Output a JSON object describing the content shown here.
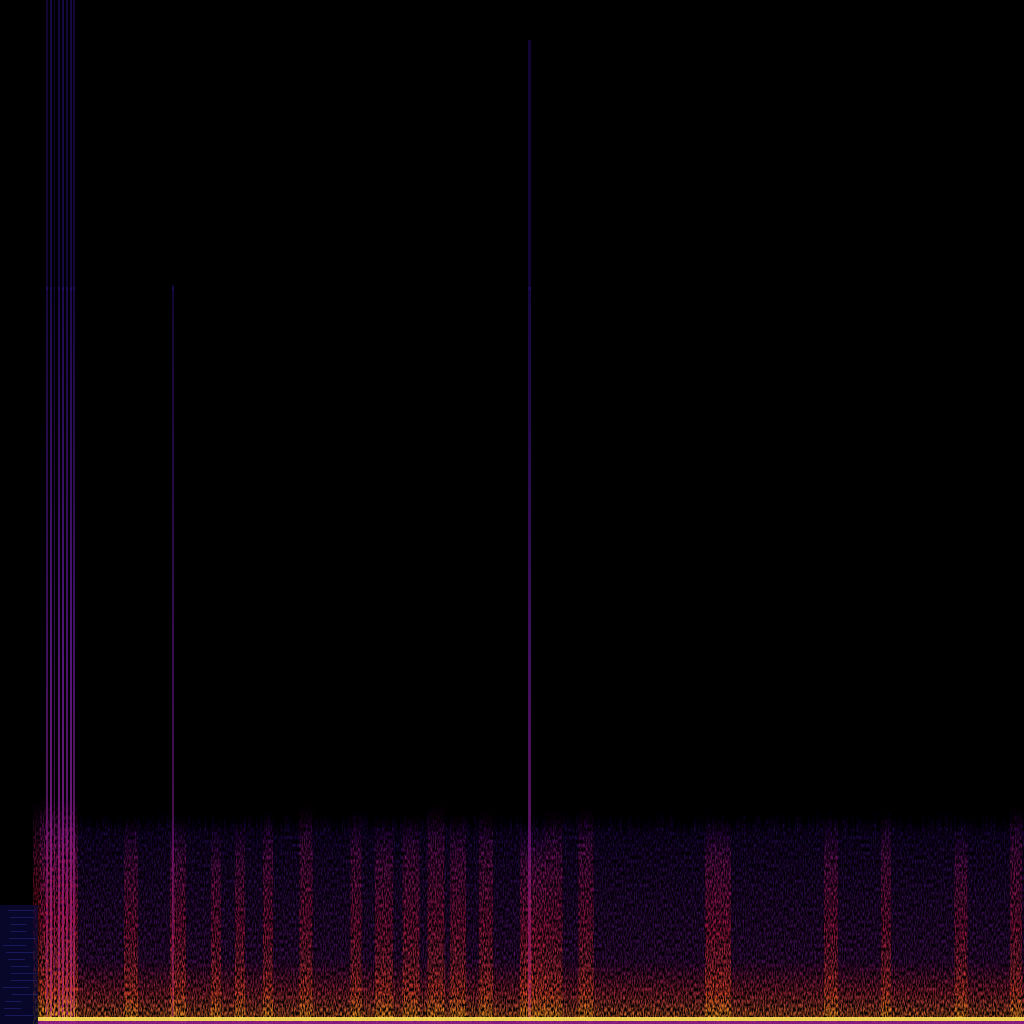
{
  "image": {
    "kind": "spectrogram",
    "colormap": "inferno-like",
    "background_color": "#000000",
    "palette": {
      "low": "#1a0a4a",
      "mid_low": "#4b0f7a",
      "mid": "#8a1a8a",
      "mid_high": "#d4142a",
      "high": "#ff4a1a",
      "peak": "#ffd21e",
      "top": "#fff28a"
    }
  },
  "spectrogram": {
    "time_frames": 1024,
    "energy_profile": {
      "noise_floor_level": 0.55,
      "transient_count": 22
    }
  }
}
